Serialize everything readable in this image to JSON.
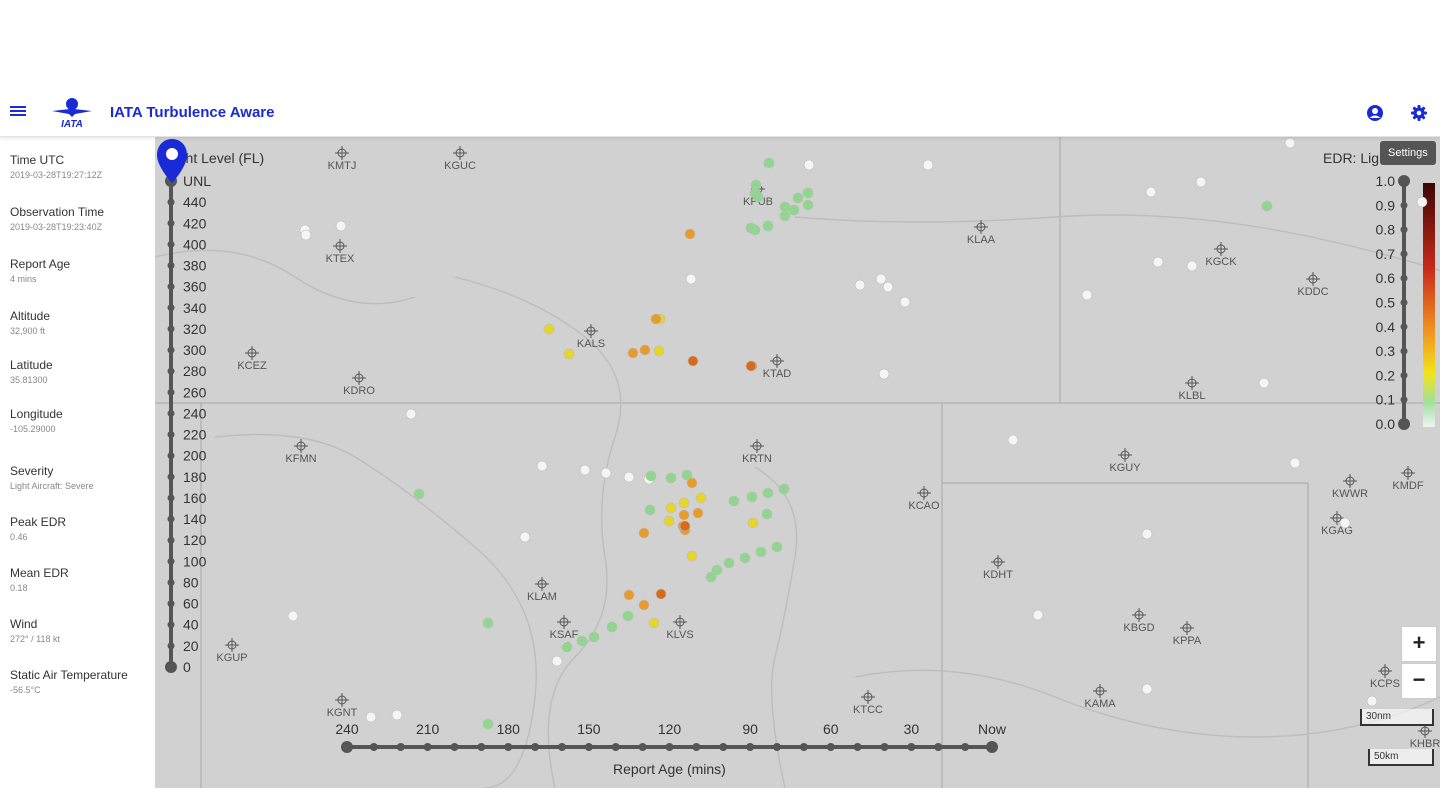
{
  "header": {
    "title": "IATA Turbulence Aware",
    "logo_text": "IATA"
  },
  "sidebar": [
    {
      "label": "Time UTC",
      "value": "2019-03-28T19:27:12Z"
    },
    {
      "label": "Observation Time",
      "value": "2019-03-28T19:23:40Z"
    },
    {
      "label": "Report Age",
      "value": "4 mins"
    },
    {
      "label": "Altitude",
      "value": "32,900 ft"
    },
    {
      "label": "Latitude",
      "value": "35.81300"
    },
    {
      "label": "Longitude",
      "value": "-105.29000"
    },
    {
      "label": "Severity",
      "value": "Light Aircraft: Severe"
    },
    {
      "label": "Peak EDR",
      "value": "0.46"
    },
    {
      "label": "Mean EDR",
      "value": "0.18"
    },
    {
      "label": "Wind",
      "value": "272° / 118 kt"
    },
    {
      "label": "Static Air Temperature",
      "value": "-56.5°C"
    }
  ],
  "map": {
    "flight_level": {
      "title": "Flight Level (FL)",
      "ticks": [
        "UNL",
        "440",
        "420",
        "400",
        "380",
        "360",
        "340",
        "320",
        "300",
        "280",
        "260",
        "240",
        "220",
        "200",
        "180",
        "160",
        "140",
        "120",
        "100",
        "80",
        "60",
        "40",
        "20",
        "0"
      ]
    },
    "edr": {
      "title": "EDR: Light",
      "ticks": [
        "1.0",
        "0.9",
        "0.8",
        "0.7",
        "0.6",
        "0.5",
        "0.4",
        "0.3",
        "0.2",
        "0.1",
        "0.0"
      ]
    },
    "report_age": {
      "title": "Report Age (mins)",
      "ticks": [
        "240",
        "210",
        "180",
        "150",
        "120",
        "90",
        "60",
        "30",
        "Now"
      ]
    },
    "settings_tooltip": "Settings",
    "zoom_in": "+",
    "zoom_out": "−",
    "scale_nm": "30nm",
    "scale_km": "50km",
    "airports": [
      "KMTJ",
      "KGUC",
      "KPUB",
      "KLAA",
      "KGCK",
      "KDDC",
      "KTEX",
      "KALS",
      "KCEZ",
      "KDRO",
      "KTAD",
      "KLBL",
      "KFMN",
      "KRTN",
      "KGUY",
      "KCAO",
      "KWWR",
      "KMDF",
      "KGAG",
      "KDHT",
      "KLAM",
      "KSAF",
      "KLVS",
      "KBGD",
      "KPPA",
      "KGUP",
      "KGNT",
      "KTCC",
      "KAMA",
      "KCPS",
      "KHBR"
    ]
  }
}
